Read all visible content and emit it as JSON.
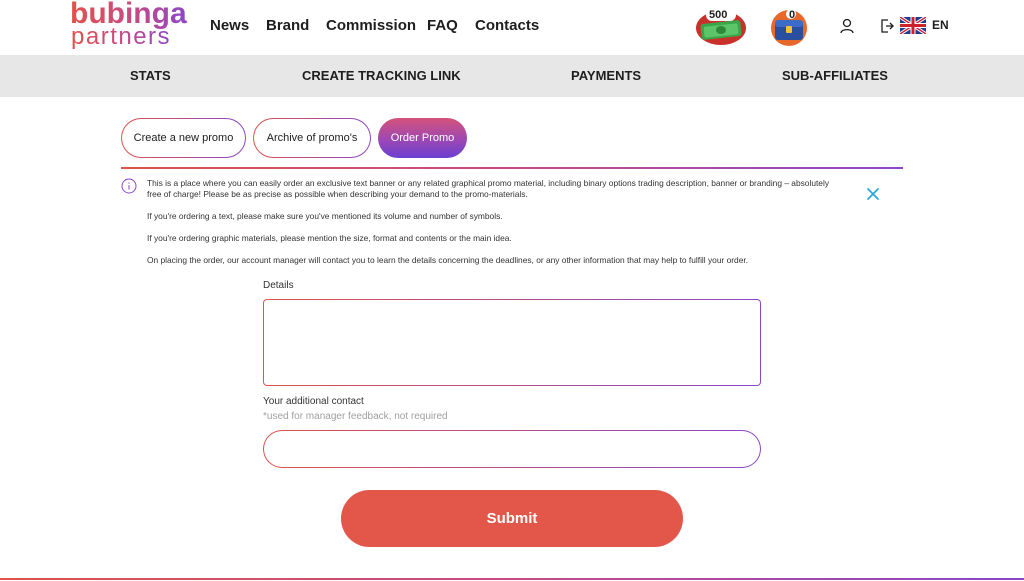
{
  "logo": {
    "line1": "bubinga",
    "line2": "partners"
  },
  "nav": {
    "items": [
      "News",
      "Brand",
      "Commission",
      "FAQ",
      "Contacts"
    ]
  },
  "badges": {
    "money_count": "500",
    "chest_count": "0"
  },
  "language": {
    "code": "EN",
    "flag_icon": "uk-flag-icon"
  },
  "subnav": {
    "items": [
      "STATS",
      "CREATE TRACKING LINK",
      "PAYMENTS",
      "SUB-AFFILIATES"
    ]
  },
  "tabs": [
    {
      "label": "Create a new promo",
      "active": false
    },
    {
      "label": "Archive of promo's",
      "active": false
    },
    {
      "label": "Order Promo",
      "active": true
    }
  ],
  "info": {
    "paragraphs": [
      "This is a place where you can easily order an exclusive text banner or any related graphical promo material, including binary options trading description, banner or branding – absolutely free of charge! Please be as precise as possible when describing your demand to the promo-materials.",
      "If you're ordering a text, please make sure you've mentioned its volume and number of symbols.",
      "If you're ordering graphic materials, please mention the size, format and contents or the main idea.",
      "On placing the order, our account manager will contact you to learn the details concerning the deadlines, or any other information that may help to fulfill your order."
    ]
  },
  "form": {
    "details_label": "Details",
    "details_value": "",
    "contact_label": "Your additional contact",
    "contact_hint": "*used for manager feedback, not required",
    "contact_value": "",
    "submit_label": "Submit"
  },
  "colors": {
    "accent_red": "#e3574a",
    "accent_purple": "#8a47c9",
    "subnav_bg": "#e7e7e7",
    "close_icon": "#2aa7dd"
  }
}
